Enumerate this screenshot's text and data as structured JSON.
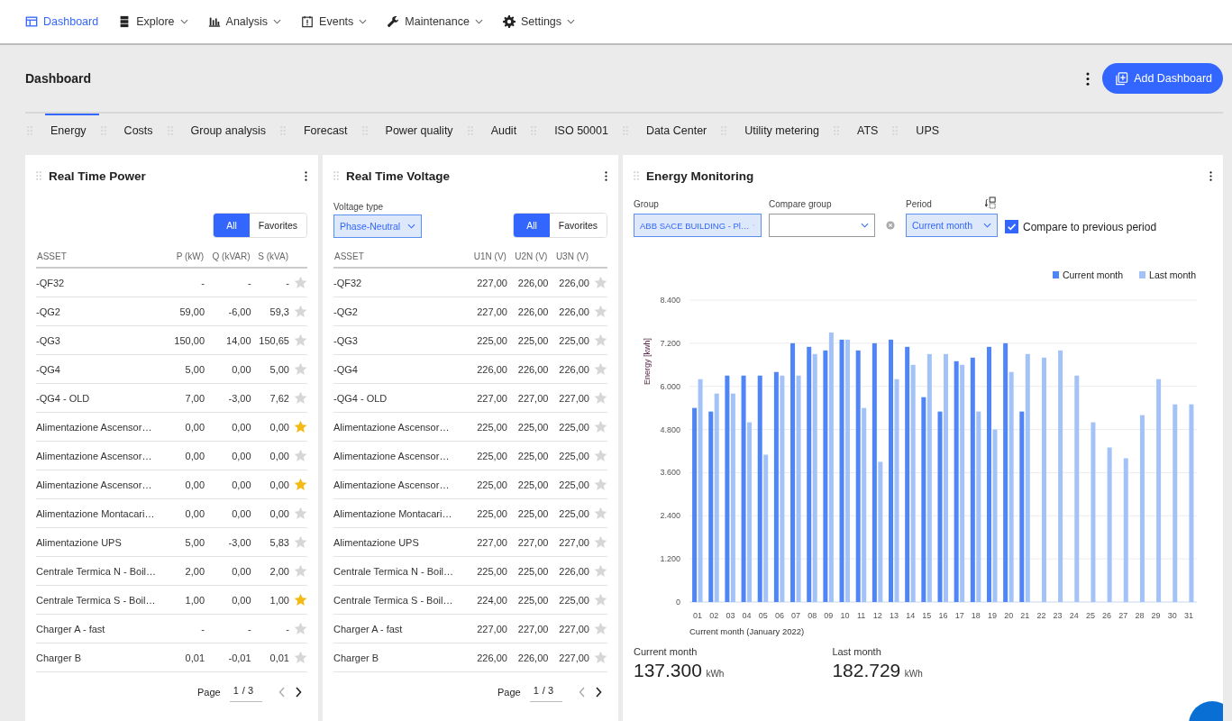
{
  "nav": [
    {
      "label": "Dashboard",
      "selected": true,
      "dropdown": false
    },
    {
      "label": "Explore",
      "selected": false,
      "dropdown": true
    },
    {
      "label": "Analysis",
      "selected": false,
      "dropdown": true
    },
    {
      "label": "Events",
      "selected": false,
      "dropdown": true
    },
    {
      "label": "Maintenance",
      "selected": false,
      "dropdown": true
    },
    {
      "label": "Settings",
      "selected": false,
      "dropdown": true
    }
  ],
  "page": {
    "title": "Dashboard",
    "add_button": "Add Dashboard"
  },
  "tabs": [
    {
      "label": "Energy",
      "selected": true
    },
    {
      "label": "Costs",
      "selected": false
    },
    {
      "label": "Group analysis",
      "selected": false
    },
    {
      "label": "Forecast",
      "selected": false
    },
    {
      "label": "Power quality",
      "selected": false
    },
    {
      "label": "Audit",
      "selected": false
    },
    {
      "label": "ISO 50001",
      "selected": false
    },
    {
      "label": "Data Center",
      "selected": false
    },
    {
      "label": "Utility metering",
      "selected": false
    },
    {
      "label": "ATS",
      "selected": false
    },
    {
      "label": "UPS",
      "selected": false
    }
  ],
  "power": {
    "title": "Real Time Power",
    "filter": [
      {
        "label": "All",
        "selected": true
      },
      {
        "label": "Favorites",
        "selected": false
      }
    ],
    "columns": [
      "ASSET",
      "P (kW)",
      "Q (kVAR)",
      "S (kVA)"
    ],
    "rows": [
      {
        "cells": [
          "-QF32",
          "-",
          "-",
          "-"
        ],
        "favorite": false
      },
      {
        "cells": [
          "-QG2",
          "59,00",
          "-6,00",
          "59,3"
        ],
        "favorite": false
      },
      {
        "cells": [
          "-QG3",
          "150,00",
          "14,00",
          "150,65"
        ],
        "favorite": false
      },
      {
        "cells": [
          "-QG4",
          "5,00",
          "0,00",
          "5,00"
        ],
        "favorite": false
      },
      {
        "cells": [
          "-QG4 - OLD",
          "7,00",
          "-3,00",
          "7,62"
        ],
        "favorite": false
      },
      {
        "cells": [
          "Alimentazione Ascensor…",
          "0,00",
          "0,00",
          "0,00"
        ],
        "favorite": true
      },
      {
        "cells": [
          "Alimentazione Ascensor…",
          "0,00",
          "0,00",
          "0,00"
        ],
        "favorite": false
      },
      {
        "cells": [
          "Alimentazione Ascensor…",
          "0,00",
          "0,00",
          "0,00"
        ],
        "favorite": true
      },
      {
        "cells": [
          "Alimentazione Montacari…",
          "0,00",
          "0,00",
          "0,00"
        ],
        "favorite": false
      },
      {
        "cells": [
          "Alimentazione UPS",
          "5,00",
          "-3,00",
          "5,83"
        ],
        "favorite": false
      },
      {
        "cells": [
          "Centrale Termica N - Boil…",
          "2,00",
          "0,00",
          "2,00"
        ],
        "favorite": false
      },
      {
        "cells": [
          "Centrale Termica S - Boil…",
          "1,00",
          "0,00",
          "1,00"
        ],
        "favorite": true
      },
      {
        "cells": [
          "Charger A - fast",
          "-",
          "-",
          "-"
        ],
        "favorite": false
      },
      {
        "cells": [
          "Charger B",
          "0,01",
          "-0,01",
          "0,01"
        ],
        "favorite": false
      }
    ],
    "pager": {
      "label": "Page",
      "current": "1",
      "separator": "/",
      "total": "3"
    }
  },
  "voltage": {
    "title": "Real Time Voltage",
    "type_label": "Voltage type",
    "type_value": "Phase-Neutral",
    "filter": [
      {
        "label": "All",
        "selected": true
      },
      {
        "label": "Favorites",
        "selected": false
      }
    ],
    "columns": [
      "ASSET",
      "U1N (V)",
      "U2N (V)",
      "U3N (V)"
    ],
    "rows": [
      {
        "cells": [
          "-QF32",
          "227,00",
          "226,00",
          "226,00"
        ],
        "favorite": false
      },
      {
        "cells": [
          "-QG2",
          "227,00",
          "226,00",
          "226,00"
        ],
        "favorite": false
      },
      {
        "cells": [
          "-QG3",
          "225,00",
          "225,00",
          "225,00"
        ],
        "favorite": false
      },
      {
        "cells": [
          "-QG4",
          "226,00",
          "226,00",
          "226,00"
        ],
        "favorite": false
      },
      {
        "cells": [
          "-QG4 - OLD",
          "227,00",
          "227,00",
          "227,00"
        ],
        "favorite": false
      },
      {
        "cells": [
          "Alimentazione Ascensor…",
          "225,00",
          "225,00",
          "225,00"
        ],
        "favorite": false
      },
      {
        "cells": [
          "Alimentazione Ascensor…",
          "225,00",
          "225,00",
          "225,00"
        ],
        "favorite": false
      },
      {
        "cells": [
          "Alimentazione Ascensor…",
          "225,00",
          "225,00",
          "225,00"
        ],
        "favorite": false
      },
      {
        "cells": [
          "Alimentazione Montacari…",
          "225,00",
          "225,00",
          "225,00"
        ],
        "favorite": false
      },
      {
        "cells": [
          "Alimentazione UPS",
          "227,00",
          "227,00",
          "227,00"
        ],
        "favorite": false
      },
      {
        "cells": [
          "Centrale Termica N - Boil…",
          "225,00",
          "225,00",
          "226,00"
        ],
        "favorite": false
      },
      {
        "cells": [
          "Centrale Termica S - Boil…",
          "224,00",
          "225,00",
          "225,00"
        ],
        "favorite": false
      },
      {
        "cells": [
          "Charger A - fast",
          "227,00",
          "227,00",
          "227,00"
        ],
        "favorite": false
      },
      {
        "cells": [
          "Charger B",
          "226,00",
          "226,00",
          "227,00"
        ],
        "favorite": false
      }
    ],
    "pager": {
      "label": "Page",
      "current": "1",
      "separator": "/",
      "total": "3"
    }
  },
  "energy": {
    "title": "Energy Monitoring",
    "group": {
      "label": "Group",
      "value": "ABB SACE BUILDING - Pl…"
    },
    "compare_group": {
      "label": "Compare group"
    },
    "period": {
      "label": "Period",
      "value": "Current month"
    },
    "compare_previous": {
      "label": "Compare to previous period",
      "checked": true
    },
    "chart_data": {
      "type": "bar",
      "ylabel": "Energy [kwh]",
      "xlabel": "Current month (January 2022)",
      "categories": [
        "01",
        "02",
        "03",
        "04",
        "05",
        "06",
        "07",
        "08",
        "09",
        "10",
        "11",
        "12",
        "13",
        "14",
        "15",
        "16",
        "17",
        "18",
        "19",
        "20",
        "21",
        "22",
        "23",
        "24",
        "25",
        "26",
        "27",
        "28",
        "29",
        "30",
        "31"
      ],
      "ylim": [
        0,
        8400
      ],
      "grid": true,
      "yticks": [
        {
          "value": 0,
          "label": "0"
        },
        {
          "value": 1200,
          "label": "1.200"
        },
        {
          "value": 2400,
          "label": "2.400"
        },
        {
          "value": 3600,
          "label": "3.600"
        },
        {
          "value": 4800,
          "label": "4.800"
        },
        {
          "value": 6000,
          "label": "6.000"
        },
        {
          "value": 7200,
          "label": "7.200"
        },
        {
          "value": 8400,
          "label": "8.400"
        }
      ],
      "series": [
        {
          "name": "Current month",
          "color": "#4f85f7",
          "values": [
            5400,
            5300,
            6300,
            6300,
            6300,
            6400,
            7200,
            7100,
            7000,
            7300,
            7000,
            7200,
            7300,
            7100,
            5700,
            5300,
            6700,
            6800,
            7100,
            7200,
            5300,
            null,
            null,
            null,
            null,
            null,
            null,
            null,
            null,
            null,
            null
          ]
        },
        {
          "name": "Last month",
          "color": "#a3c2f7",
          "values": [
            6200,
            5800,
            5800,
            5000,
            4100,
            6300,
            6300,
            6900,
            7500,
            7300,
            5400,
            3900,
            6200,
            6600,
            6900,
            6900,
            6600,
            5300,
            4800,
            6400,
            6900,
            6800,
            7000,
            6300,
            5000,
            4300,
            4000,
            5200,
            6200,
            5500,
            5500
          ]
        }
      ]
    },
    "totals": [
      {
        "label": "Current month",
        "value": "137.300",
        "unit": "kWh"
      },
      {
        "label": "Last month",
        "value": "182.729",
        "unit": "kWh"
      }
    ]
  }
}
